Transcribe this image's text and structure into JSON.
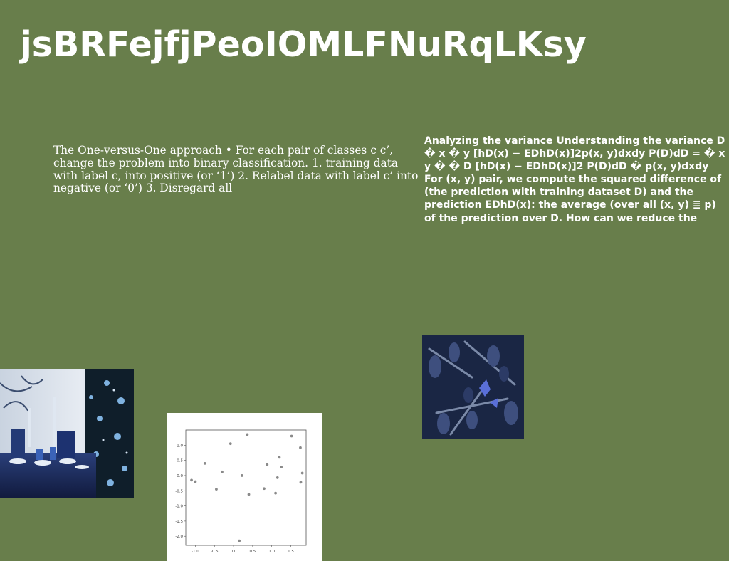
{
  "title": "jsBRFejfjPeoIOMLFNuRqLKsy",
  "left_text": "The One-versus-One approach • For each pair of classes c c’, change the problem into binary classification. 1. training data with label c, into positive (or ‘1’) 2. Relabel data with label c’ into negative (or ‘0’) 3. Disregard all",
  "right_text": "Analyzing the variance Understanding the variance D � x � y [hD(x) − EDhD(x)]2p(x, y)dxdy P(D)dD = � x y � � D [hD(x) − EDhD(x)]2 P(D)dD � p(x, y)dxdy For (x, y) pair, we compute the squared difference of (the prediction with training dataset D) and the prediction EDhD(x): the average (over all (x, y) ≣ p) of the prediction over D. How can we reduce the",
  "chart_data": {
    "type": "scatter",
    "xlim": [
      -1.25,
      1.9
    ],
    "ylim": [
      -2.3,
      1.5
    ],
    "x_ticks": [
      "-1.0",
      "-0.5",
      "0.0",
      "0.5",
      "1.0",
      "1.5"
    ],
    "y_ticks": [
      "1.0",
      "0.5",
      "0.0",
      "-0.5",
      "-1.0",
      "-1.5",
      "-2.0"
    ],
    "points": [
      {
        "x": -1.1,
        "y": -0.15
      },
      {
        "x": -1.0,
        "y": -0.2
      },
      {
        "x": -0.75,
        "y": 0.4
      },
      {
        "x": -0.45,
        "y": -0.45
      },
      {
        "x": -0.3,
        "y": 0.12
      },
      {
        "x": -0.08,
        "y": 1.05
      },
      {
        "x": 0.15,
        "y": -2.15
      },
      {
        "x": 0.22,
        "y": 0.0
      },
      {
        "x": 0.36,
        "y": 1.35
      },
      {
        "x": 0.4,
        "y": -0.62
      },
      {
        "x": 0.8,
        "y": -0.43
      },
      {
        "x": 0.88,
        "y": 0.36
      },
      {
        "x": 1.1,
        "y": -0.58
      },
      {
        "x": 1.15,
        "y": -0.07
      },
      {
        "x": 1.2,
        "y": 0.6
      },
      {
        "x": 1.25,
        "y": 0.28
      },
      {
        "x": 1.52,
        "y": 1.3
      },
      {
        "x": 1.75,
        "y": 0.92
      },
      {
        "x": 1.76,
        "y": -0.22
      },
      {
        "x": 1.8,
        "y": 0.08
      }
    ]
  }
}
